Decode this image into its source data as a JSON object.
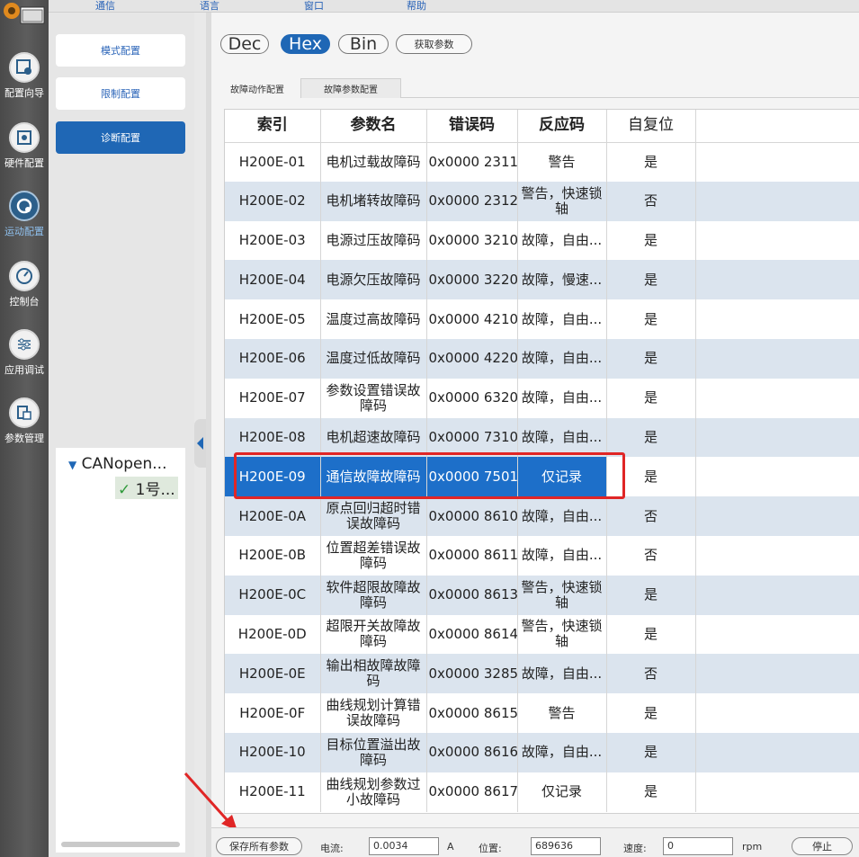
{
  "menu": [
    "通信",
    "语言",
    "窗口",
    "帮助"
  ],
  "nav": [
    {
      "label": "配置向导",
      "icon": "wizard-icon"
    },
    {
      "label": "硬件配置",
      "icon": "hardware-icon"
    },
    {
      "label": "运动配置",
      "icon": "motion-icon",
      "active": true
    },
    {
      "label": "控制台",
      "icon": "gauge-icon"
    },
    {
      "label": "应用调试",
      "icon": "sliders-icon"
    },
    {
      "label": "参数管理",
      "icon": "params-icon"
    }
  ],
  "config_buttons": [
    "模式配置",
    "限制配置",
    "诊断配置"
  ],
  "tree": {
    "root": "CANopen...",
    "child": "1号..."
  },
  "toolbar": {
    "dec": "Dec",
    "hex": "Hex",
    "bin": "Bin",
    "get_params": "获取参数"
  },
  "tabs": [
    "故障动作配置",
    "故障参数配置"
  ],
  "table": {
    "headers": [
      "索引",
      "参数名",
      "错误码",
      "反应码",
      "自复位"
    ],
    "rows": [
      [
        "H200E-01",
        "电机过载故障码",
        "0x0000 2311",
        "警告",
        "是"
      ],
      [
        "H200E-02",
        "电机堵转故障码",
        "0x0000 2312",
        "警告，快速锁轴",
        "否"
      ],
      [
        "H200E-03",
        "电源过压故障码",
        "0x0000 3210",
        "故障，自由...",
        "是"
      ],
      [
        "H200E-04",
        "电源欠压故障码",
        "0x0000 3220",
        "故障，慢速...",
        "是"
      ],
      [
        "H200E-05",
        "温度过高故障码",
        "0x0000 4210",
        "故障，自由...",
        "是"
      ],
      [
        "H200E-06",
        "温度过低故障码",
        "0x0000 4220",
        "故障，自由...",
        "是"
      ],
      [
        "H200E-07",
        "参数设置错误故障码",
        "0x0000 6320",
        "故障，自由...",
        "是"
      ],
      [
        "H200E-08",
        "电机超速故障码",
        "0x0000 7310",
        "故障，自由...",
        "是"
      ],
      [
        "H200E-09",
        "通信故障故障码",
        "0x0000 7501",
        "仅记录",
        "是"
      ],
      [
        "H200E-0A",
        "原点回归超时错误故障码",
        "0x0000 8610",
        "故障，自由...",
        "否"
      ],
      [
        "H200E-0B",
        "位置超差错误故障码",
        "0x0000 8611",
        "故障，自由...",
        "否"
      ],
      [
        "H200E-0C",
        "软件超限故障故障码",
        "0x0000 8613",
        "警告，快速锁轴",
        "是"
      ],
      [
        "H200E-0D",
        "超限开关故障故障码",
        "0x0000 8614",
        "警告，快速锁轴",
        "是"
      ],
      [
        "H200E-0E",
        "输出相故障故障码",
        "0x0000 3285",
        "故障，自由...",
        "否"
      ],
      [
        "H200E-0F",
        "曲线规划计算错误故障码",
        "0x0000 8615",
        "警告",
        "是"
      ],
      [
        "H200E-10",
        "目标位置溢出故障码",
        "0x0000 8616",
        "故障，自由...",
        "是"
      ],
      [
        "H200E-11",
        "曲线规划参数过小故障码",
        "0x0000 8617",
        "仅记录",
        "是"
      ]
    ],
    "selected_row": 8
  },
  "status": {
    "save_all": "保存所有参数",
    "current_label": "电流:",
    "current_value": "0.0034",
    "current_unit": "A",
    "position_label": "位置:",
    "position_value": "689636",
    "speed_label": "速度:",
    "speed_value": "0",
    "speed_unit": "rpm",
    "stop": "停止"
  },
  "colors": {
    "accent": "#1f67b5",
    "highlight": "#e02626",
    "row_alt": "#dbe4ee"
  }
}
